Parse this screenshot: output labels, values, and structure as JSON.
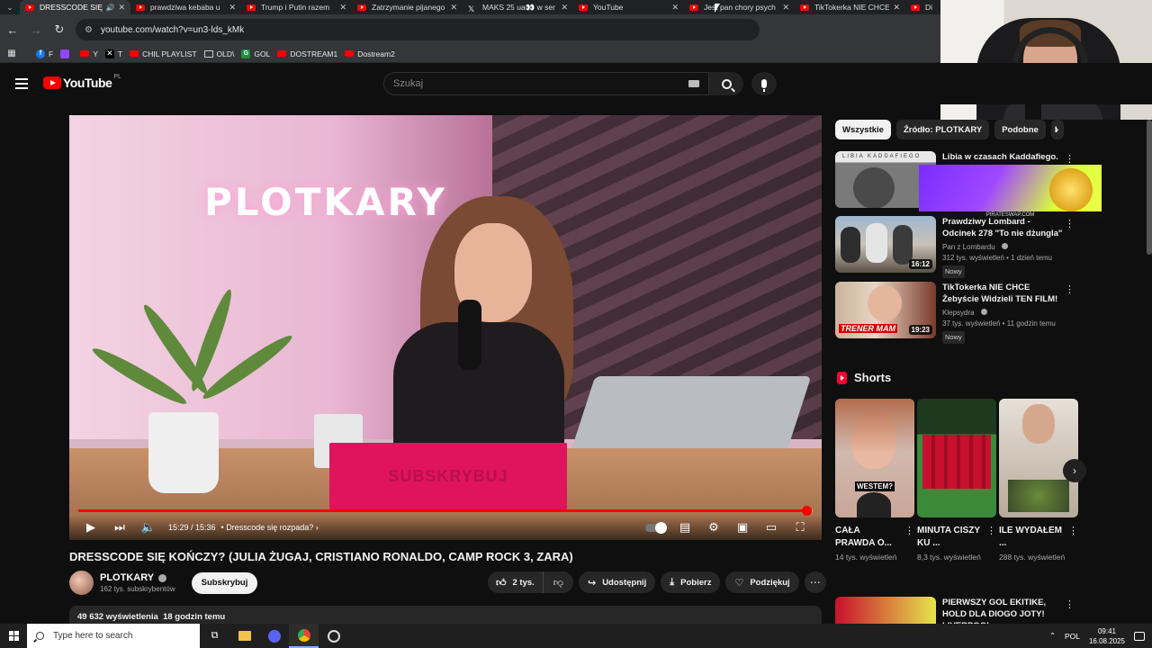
{
  "browser": {
    "tabs": [
      {
        "title": "DRESSCODE SIĘ KOŃCZY",
        "active": true,
        "audio": true
      },
      {
        "title": "prawdziwa kebaba u",
        "active": false
      },
      {
        "title": "Trump i Putin razem",
        "active": false
      },
      {
        "title": "Zatrzymanie pijanego",
        "active": false
      },
      {
        "title": "MAKS 25 ua👀 w ser",
        "active": false,
        "icon": "x"
      },
      {
        "title": "YouTube",
        "active": false
      },
      {
        "title": "Jest pan chory psych",
        "active": false
      },
      {
        "title": "TikTokerka NIE CHCE",
        "active": false
      },
      {
        "title": "Di",
        "active": false
      }
    ],
    "url": "youtube.com/watch?v=un3-lds_kMk",
    "bookmarks": [
      {
        "label": "F",
        "icon": "facebook-icon"
      },
      {
        "label": "",
        "icon": "twitch-icon"
      },
      {
        "label": "Y",
        "icon": "youtube-icon"
      },
      {
        "label": "T",
        "icon": "x-icon"
      },
      {
        "label": "CHIL PLAYLIST",
        "icon": "youtube-icon"
      },
      {
        "label": "OLD\\",
        "icon": "folder-icon"
      },
      {
        "label": "GOL",
        "icon": "gol-icon"
      },
      {
        "label": "DOSTREAM1",
        "icon": "youtube-icon"
      },
      {
        "label": "Dostream2",
        "icon": "youtube-icon"
      }
    ]
  },
  "youtube": {
    "logo": "YouTube",
    "logo_country": "PL",
    "search_placeholder": "Szukaj"
  },
  "player": {
    "neon_text": "PLOTKARY",
    "subscribe_overlay": "SUBSKRYBUJ",
    "time": "15:29 / 15:36",
    "chapter": "• Dresscode się rozpada? ›",
    "progress": 0.992
  },
  "video": {
    "title": "DRESSCODE SIĘ KOŃCZY? (JULIA ŻUGAJ, CRISTIANO RONALDO, CAMP ROCK 3, ZARA)",
    "channel": "PLOTKARY",
    "subscribers": "162 tys. subskrybentów",
    "subscribe_label": "Subskrybuj",
    "likes": "2 tys.",
    "share_label": "Udostępnij",
    "download_label": "Pobierz",
    "thanks_label": "Podziękuj",
    "views": "49 632 wyświetlenia",
    "age": "18 godzin temu"
  },
  "sidebar": {
    "chips": [
      "Wszystkie",
      "Źródło: PLOTKARY",
      "Podobne",
      "I"
    ],
    "recommendations": [
      {
        "title": "Libia w czasach Kaddafiego.",
        "channel": "",
        "meta": "",
        "badge": "",
        "duration": "",
        "thumb_text": "LIBIA KADDAFIEGO"
      },
      {
        "title": "Prawdziwy Lombard - Odcinek 278 \"To nie dżungla\"",
        "channel": "Pan z Lombardu",
        "meta": "312 tys. wyświetleń • 1 dzień temu",
        "badge": "Nowy",
        "duration": "16:12"
      },
      {
        "title": "TikTokerka NIE CHCE Żebyście Widzieli TEN FILM!",
        "channel": "Klepsydra",
        "meta": "37 tys. wyświetleń • 11 godzin temu",
        "badge": "Nowy",
        "duration": "19:23",
        "thumb_text": "TRENER MAM"
      }
    ],
    "ad_text": "PIRATESWAP.COM",
    "shorts_title": "Shorts",
    "shorts": [
      {
        "title": "CAŁA PRAWDA O...",
        "views": "14 tys. wyświetleń",
        "thumb_text": "WESTEM?"
      },
      {
        "title": "MINUTA CISZY KU ...",
        "views": "8,3 tys. wyświetleń"
      },
      {
        "title": "ILE WYDAŁEM ...",
        "views": "288 tys. wyświetleń"
      }
    ],
    "last_rec_title": "PIERWSZY GOL EKITIKE, HOLD DLA DIOGO JOTY! LIVERPOOL..."
  },
  "taskbar": {
    "search_placeholder": "Type here to search",
    "lang": "POL",
    "time": "09:41",
    "date": "16.08.2025"
  },
  "colors": {
    "yt_red": "#ff0000",
    "bg": "#0f0f0f",
    "pill": "#272727",
    "sub_overlay": "#e0135d"
  }
}
